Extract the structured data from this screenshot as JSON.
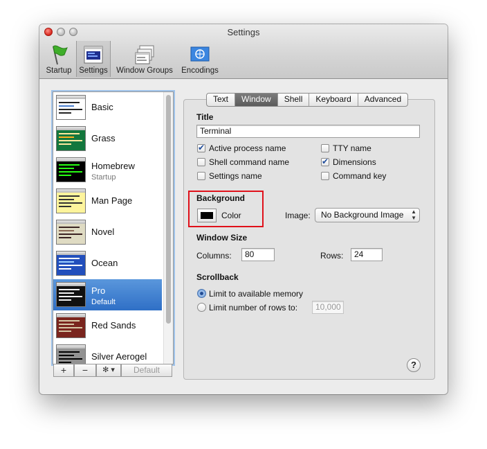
{
  "window": {
    "title": "Settings"
  },
  "toolbar": {
    "items": [
      {
        "label": "Startup",
        "icon": "green-flag-icon"
      },
      {
        "label": "Settings",
        "icon": "settings-window-icon"
      },
      {
        "label": "Window Groups",
        "icon": "window-groups-icon"
      },
      {
        "label": "Encodings",
        "icon": "un-flag-icon"
      }
    ],
    "selected": "Settings"
  },
  "profiles": [
    {
      "name": "Basic",
      "sub": ""
    },
    {
      "name": "Grass",
      "sub": ""
    },
    {
      "name": "Homebrew",
      "sub": "Startup"
    },
    {
      "name": "Man Page",
      "sub": ""
    },
    {
      "name": "Novel",
      "sub": ""
    },
    {
      "name": "Ocean",
      "sub": ""
    },
    {
      "name": "Pro",
      "sub": "Default"
    },
    {
      "name": "Red Sands",
      "sub": ""
    },
    {
      "name": "Silver Aerogel",
      "sub": ""
    }
  ],
  "selected_profile": "Pro",
  "list_buttons": {
    "add": "+",
    "remove": "−",
    "gear": "✻ ▾",
    "default": "Default"
  },
  "tabs": [
    {
      "label": "Text",
      "active": false
    },
    {
      "label": "Window",
      "active": true
    },
    {
      "label": "Shell",
      "active": false
    },
    {
      "label": "Keyboard",
      "active": false
    },
    {
      "label": "Advanced",
      "active": false
    }
  ],
  "title_section": {
    "heading": "Title",
    "value": "Terminal",
    "checks": [
      {
        "label": "Active process name",
        "checked": true
      },
      {
        "label": "Shell command name",
        "checked": false
      },
      {
        "label": "Settings name",
        "checked": false
      },
      {
        "label": "TTY name",
        "checked": false
      },
      {
        "label": "Dimensions",
        "checked": true
      },
      {
        "label": "Command key",
        "checked": false
      }
    ]
  },
  "background": {
    "heading": "Background",
    "color_label": "Color",
    "color": "#000000",
    "image_label": "Image:",
    "image_value": "No Background Image"
  },
  "window_size": {
    "heading": "Window Size",
    "columns_label": "Columns:",
    "columns": "80",
    "rows_label": "Rows:",
    "rows": "24"
  },
  "scrollback": {
    "heading": "Scrollback",
    "option1": "Limit to available memory",
    "option2": "Limit number of rows to:",
    "selected": 1,
    "rows_value": "10,000"
  },
  "help_label": "?"
}
